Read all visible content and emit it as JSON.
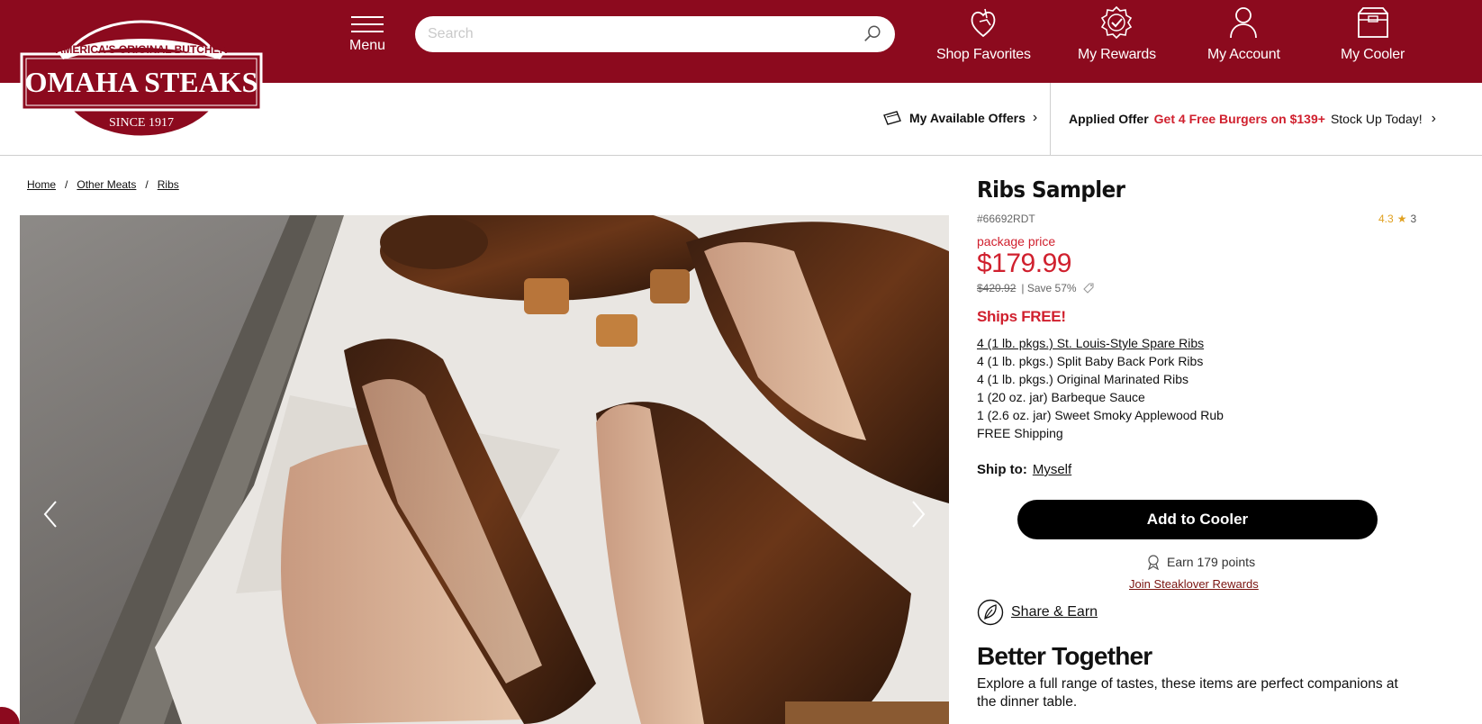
{
  "header": {
    "brand_top": "AMERICA'S ORIGINAL BUTCHER",
    "brand_name": "OMAHA STEAKS",
    "brand_since": "SINCE 1917",
    "menu_label": "Menu",
    "search_placeholder": "Search",
    "nav": [
      {
        "label": "Shop Favorites",
        "icon": "heart-hand-icon"
      },
      {
        "label": "My Rewards",
        "icon": "rewards-badge-icon"
      },
      {
        "label": "My Account",
        "icon": "user-icon"
      },
      {
        "label": "My Cooler",
        "icon": "cooler-icon"
      }
    ],
    "colors": {
      "brand": "#8c0a1e",
      "accent_red": "#d0202e",
      "star": "#e0a020"
    }
  },
  "offers": {
    "available_label": "My Available Offers",
    "applied_label": "Applied Offer",
    "applied_deal": "Get 4 Free Burgers on $139+",
    "applied_cta": "Stock Up Today!"
  },
  "breadcrumb": [
    {
      "label": "Home"
    },
    {
      "label": "Other Meats"
    },
    {
      "label": "Ribs"
    }
  ],
  "breadcrumb_sep": "/",
  "product": {
    "title": "Ribs Sampler",
    "sku": "#66692RDT",
    "rating": "4.3",
    "review_count": "3",
    "package_label": "package price",
    "price": "$179.99",
    "was_price": "$420.92",
    "save_text": "| Save 57%",
    "ships_free": "Ships FREE!",
    "contents": [
      "4 (1 lb. pkgs.) St. Louis-Style Spare Ribs",
      "4 (1 lb. pkgs.) Split Baby Back Pork Ribs",
      "4 (1 lb. pkgs.) Original Marinated Ribs",
      "1 (20 oz. jar) Barbeque Sauce",
      "1 (2.6 oz. jar) Sweet Smoky Applewood Rub",
      "FREE Shipping"
    ],
    "ship_to_label": "Ship to:",
    "ship_to_value": "Myself",
    "add_button": "Add to Cooler",
    "earn_points": "Earn 179 points",
    "join_link": "Join Steaklover Rewards",
    "share_label": "Share & Earn"
  },
  "better_together": {
    "title": "Better Together",
    "description": "Explore a full range of tastes, these items are perfect companions at the dinner table."
  }
}
